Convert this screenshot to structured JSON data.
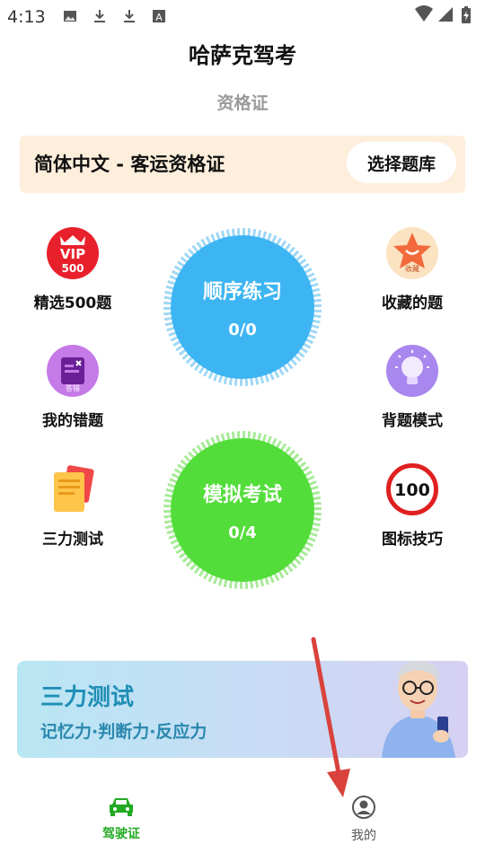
{
  "status_bar": {
    "time": "4:13",
    "icons": [
      "image-icon",
      "download-icon",
      "download-icon",
      "font-a-icon",
      "wifi-icon",
      "signal-icon",
      "battery-charging-icon"
    ]
  },
  "header": {
    "title": "哈萨克驾考",
    "subtitle": "资格证"
  },
  "bank": {
    "label": "简体中文 - 客运资格证",
    "button": "选择题库"
  },
  "features_left": [
    {
      "label": "精选500题",
      "icon": "vip-500-icon",
      "icon_text_top": "VIP",
      "icon_text_bottom": "500"
    },
    {
      "label": "我的错题",
      "icon": "wrong-answers-icon",
      "icon_text": "答错"
    },
    {
      "label": "三力测试",
      "icon": "notepad-icon"
    }
  ],
  "features_right": [
    {
      "label": "收藏的题",
      "icon": "star-favorite-icon",
      "icon_text": "收藏"
    },
    {
      "label": "背题模式",
      "icon": "lightbulb-icon"
    },
    {
      "label": "图标技巧",
      "icon": "speed-limit-sign-icon",
      "icon_text": "100"
    }
  ],
  "practice": {
    "title": "顺序练习",
    "count": "0/0",
    "color": "#3db5f2"
  },
  "exam": {
    "title": "模拟考试",
    "count": "0/4",
    "color": "#53dd3a"
  },
  "banner": {
    "title": "三力测试",
    "subtitle": "记忆力·判断力·反应力"
  },
  "tabs": [
    {
      "label": "驾驶证",
      "icon": "car-icon",
      "active": true,
      "color": "#22aa22"
    },
    {
      "label": "我的",
      "icon": "person-icon",
      "active": false,
      "color": "#555555"
    }
  ]
}
